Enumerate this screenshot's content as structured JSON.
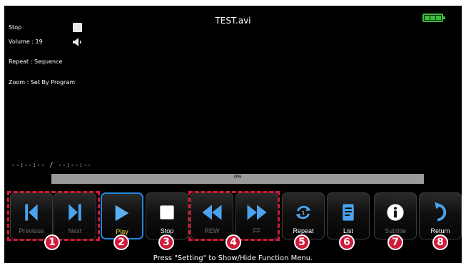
{
  "player": {
    "file_title": "TEST.avi",
    "status": "Stop",
    "volume": "Volume : 19",
    "repeat": "Repeat : Sequence",
    "zoom": "Zoom : Set By Program",
    "timecode": "--:--:-- / --:--:--",
    "progress_percent": 0,
    "progress_label": "0%",
    "battery_icon": "battery-icon",
    "accent_color": "#1f87e0",
    "highlight_color": "#d11a3a"
  },
  "controls": {
    "previous": "Previous",
    "next": "Next",
    "play": "Play",
    "stop": "Stop",
    "rew": "REW",
    "ff": "FF",
    "repeat": "Repeat",
    "list": "List",
    "subtitle": "Subtitle",
    "return": "Return"
  },
  "badges": [
    "1",
    "2",
    "3",
    "4",
    "5",
    "6",
    "7",
    "8"
  ],
  "hint": "Press \"Setting\" to Show/Hide Function Menu."
}
